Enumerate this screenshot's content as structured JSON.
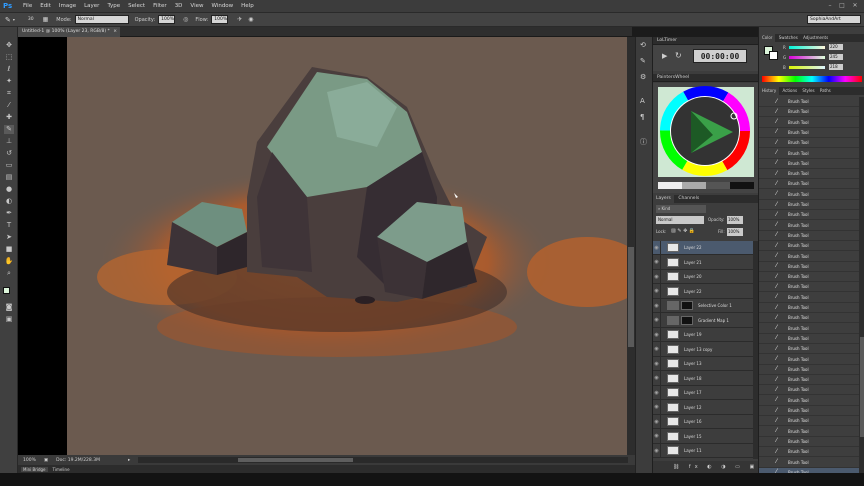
{
  "app": {
    "logo": "Ps"
  },
  "menu": [
    "File",
    "Edit",
    "Image",
    "Layer",
    "Type",
    "Select",
    "Filter",
    "3D",
    "View",
    "Window",
    "Help"
  ],
  "options": {
    "mode_label": "Mode:",
    "mode_value": "Normal",
    "opacity_label": "Opacity:",
    "opacity_value": "100%",
    "flow_label": "Flow:",
    "flow_value": "100%",
    "brush_size": "30",
    "workspace": "SophiaAndArt"
  },
  "document": {
    "tab_title": "Untitled-1 @ 100% (Layer 23, RGB/8) *"
  },
  "status": {
    "zoom": "100%",
    "doc_info": "Doc: 19.2M/228.3M"
  },
  "bridge": {
    "tab1": "Mini Bridge",
    "tab2": "Timeline"
  },
  "timer": {
    "panel_title": "LoLTimer",
    "time": "00:00:00"
  },
  "wheel": {
    "panel_title": "PaintersWheel"
  },
  "layers_panel": {
    "tab_layers": "Layers",
    "tab_channels": "Channels",
    "kind_label": "Kind",
    "blend_mode": "Normal",
    "opacity_label": "Opacity:",
    "opacity_value": "100%",
    "lock_label": "Lock:",
    "fill_label": "Fill:",
    "fill_value": "100%",
    "layers": [
      {
        "name": "Layer 22",
        "mask": false,
        "selected": true
      },
      {
        "name": "Layer 21",
        "mask": false,
        "selected": false
      },
      {
        "name": "Layer 20",
        "mask": false,
        "selected": false
      },
      {
        "name": "Layer 22",
        "mask": false,
        "selected": false
      },
      {
        "name": "Selective Color 1",
        "mask": true,
        "selected": false
      },
      {
        "name": "Gradient Map 1",
        "mask": true,
        "selected": false
      },
      {
        "name": "Layer 19",
        "mask": false,
        "selected": false
      },
      {
        "name": "Layer 13 copy",
        "mask": false,
        "selected": false
      },
      {
        "name": "Layer 13",
        "mask": false,
        "selected": false
      },
      {
        "name": "Layer 18",
        "mask": false,
        "selected": false
      },
      {
        "name": "Layer 17",
        "mask": false,
        "selected": false
      },
      {
        "name": "Layer 12",
        "mask": false,
        "selected": false
      },
      {
        "name": "Layer 16",
        "mask": false,
        "selected": false
      },
      {
        "name": "Layer 15",
        "mask": false,
        "selected": false
      },
      {
        "name": "Layer 11",
        "mask": false,
        "selected": false
      }
    ]
  },
  "color_panel": {
    "tab_color": "Color",
    "tab_swatches": "Swatches",
    "tab_adjustments": "Adjustments",
    "r_label": "R",
    "r_value": "220",
    "g_label": "G",
    "g_value": "245",
    "b_label": "B",
    "b_value": "218"
  },
  "history_panel": {
    "tab_history": "History",
    "tab_actions": "Actions",
    "tab_styles": "Styles",
    "tab_paths": "Paths",
    "items": [
      "Brush Tool",
      "Brush Tool",
      "Brush Tool",
      "Brush Tool",
      "Brush Tool",
      "Brush Tool",
      "Brush Tool",
      "Brush Tool",
      "Brush Tool",
      "Brush Tool",
      "Brush Tool",
      "Brush Tool",
      "Brush Tool",
      "Brush Tool",
      "Brush Tool",
      "Brush Tool",
      "Brush Tool",
      "Brush Tool",
      "Brush Tool",
      "Brush Tool",
      "Brush Tool",
      "Brush Tool",
      "Brush Tool",
      "Brush Tool",
      "Brush Tool",
      "Brush Tool",
      "Brush Tool",
      "Brush Tool",
      "Brush Tool",
      "Brush Tool",
      "Brush Tool",
      "Brush Tool",
      "Brush Tool",
      "Brush Tool",
      "Brush Tool",
      "Brush Tool",
      "Brush Tool"
    ]
  },
  "colors": {
    "accent": "#2f9bff",
    "selected_row": "#4b5a6e",
    "canvas_bg": "#6b5a4f"
  },
  "icons": [
    "brush-icon",
    "eye-icon",
    "move-tool-icon",
    "lasso-tool-icon",
    "crop-tool-icon",
    "eyedropper-tool-icon",
    "brush-tool-icon",
    "eraser-tool-icon",
    "gradient-tool-icon",
    "pen-tool-icon",
    "type-tool-icon",
    "hand-tool-icon",
    "zoom-tool-icon"
  ]
}
